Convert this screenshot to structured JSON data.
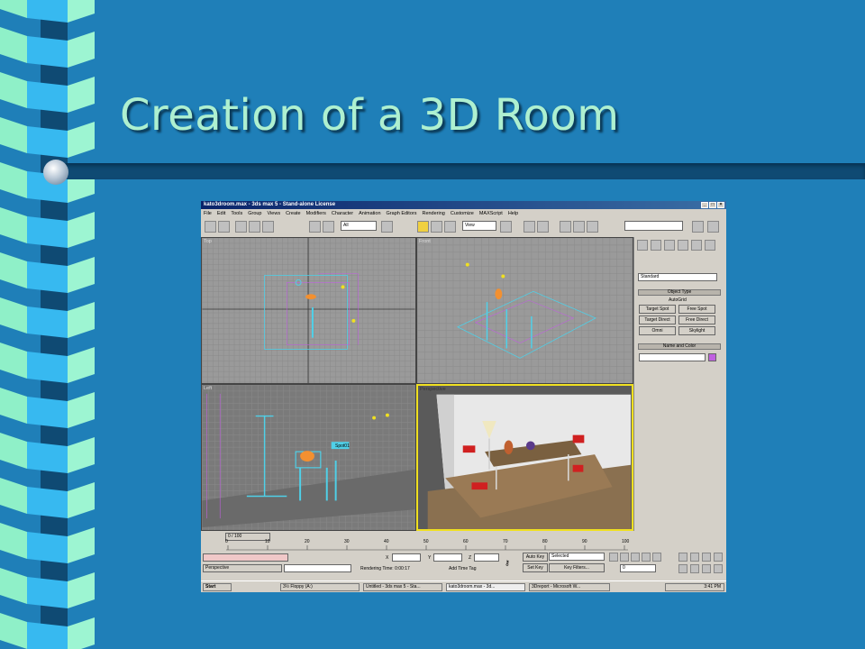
{
  "slide": {
    "title": "Creation of a 3D Room",
    "colors": {
      "background": "#1f7fb8",
      "title": "#aef0d0",
      "rule": "#0f4a73"
    }
  },
  "app": {
    "window_title": "kato3droom.max - 3ds max 5 - Stand-alone License",
    "menu": [
      "File",
      "Edit",
      "Tools",
      "Group",
      "Views",
      "Create",
      "Modifiers",
      "Character",
      "Animation",
      "Graph Editors",
      "Rendering",
      "Customize",
      "MAXScript",
      "Help"
    ],
    "toolbar": {
      "selection_filter": "All",
      "reference_coord": "View"
    },
    "viewports": {
      "top": "Top",
      "front": "Front",
      "left": "Left",
      "perspective": "Perspective"
    },
    "command_panel": {
      "category": "Standard",
      "object_type_header": "Object Type",
      "autogrid_label": "AutoGrid",
      "buttons": [
        "Target Spot",
        "Free Spot",
        "Target Direct",
        "Free Direct",
        "Omni",
        "Skylight"
      ],
      "name_color_header": "Name and Color"
    },
    "timeline": {
      "frame_display": "0 / 100",
      "ticks": [
        "0",
        "10",
        "20",
        "30",
        "40",
        "50",
        "60",
        "70",
        "80",
        "90",
        "100"
      ]
    },
    "status": {
      "viewport_name": "Perspective",
      "x_label": "X",
      "y_label": "Y",
      "z_label": "Z",
      "rendering_time": "Rendering Time: 0:00:17",
      "add_time_tag": "Add Time Tag",
      "auto_key": "Auto Key",
      "set_key": "Set Key",
      "selected": "Selected",
      "key_filters": "Key Filters...",
      "frame_field": "0",
      "spot_label": "Spot01"
    },
    "taskbar": {
      "start": "Start",
      "tasks": [
        "3½ Floppy (A:)",
        "Untitled - 3ds max 5 - Sta...",
        "kato3droom.max - 3d...",
        "3Dreport - Microsoft W..."
      ],
      "clock": "3:41 PM"
    }
  }
}
